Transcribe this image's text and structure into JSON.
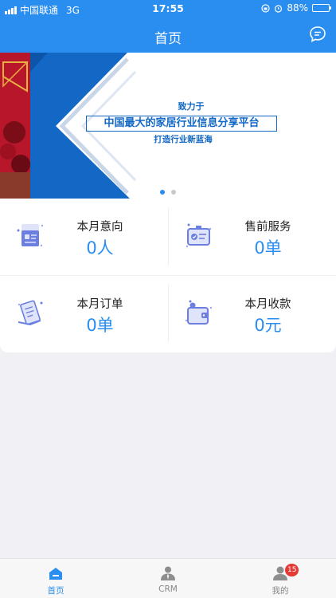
{
  "status_bar": {
    "carrier": "中国联通",
    "network": "3G",
    "time": "17:55",
    "battery": "88%",
    "battery_level": 0.88
  },
  "nav": {
    "title": "首页",
    "message_icon": "chat-bubble-icon"
  },
  "banner": {
    "line1": "致力于",
    "headline": "中国最大的家居行业信息分享平台",
    "line3": "打造行业新蓝海",
    "page_count": 2,
    "active_page": 1
  },
  "stats": [
    {
      "label": "本月意向",
      "value": "0人",
      "icon": "intention-card-icon"
    },
    {
      "label": "售前服务",
      "value": "0单",
      "icon": "service-badge-icon"
    },
    {
      "label": "本月订单",
      "value": "0单",
      "icon": "order-document-icon"
    },
    {
      "label": "本月收款",
      "value": "0元",
      "icon": "wallet-icon"
    }
  ],
  "tabbar": {
    "items": [
      {
        "label": "首页",
        "icon": "home-icon",
        "active": true
      },
      {
        "label": "CRM",
        "icon": "crm-person-icon",
        "active": false
      },
      {
        "label": "我的",
        "icon": "profile-icon",
        "active": false,
        "badge": "15"
      }
    ]
  },
  "colors": {
    "primary": "#2a8df0",
    "banner_red": "#b8162a",
    "banner_blue": "#1268c4",
    "badge_red": "#e53935"
  }
}
